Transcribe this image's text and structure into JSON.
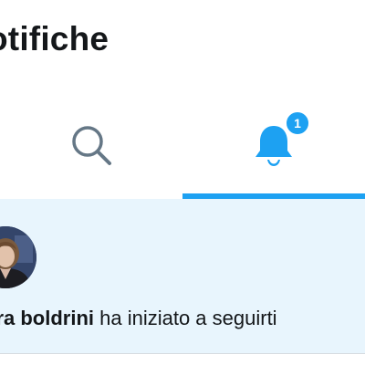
{
  "header": {
    "title": "otifiche"
  },
  "tabs": [
    {
      "name": "search",
      "icon": "search-icon",
      "active": false
    },
    {
      "name": "notifications",
      "icon": "bell-icon",
      "active": true,
      "badge": "1"
    }
  ],
  "colors": {
    "accent": "#1da1f2",
    "icon_inactive": "#657786",
    "text": "#14171a",
    "unread_background": "#e8f5fd"
  },
  "notification": {
    "user_name": "ura boldrini",
    "message": "ha iniziato a seguirti",
    "unread": true
  }
}
